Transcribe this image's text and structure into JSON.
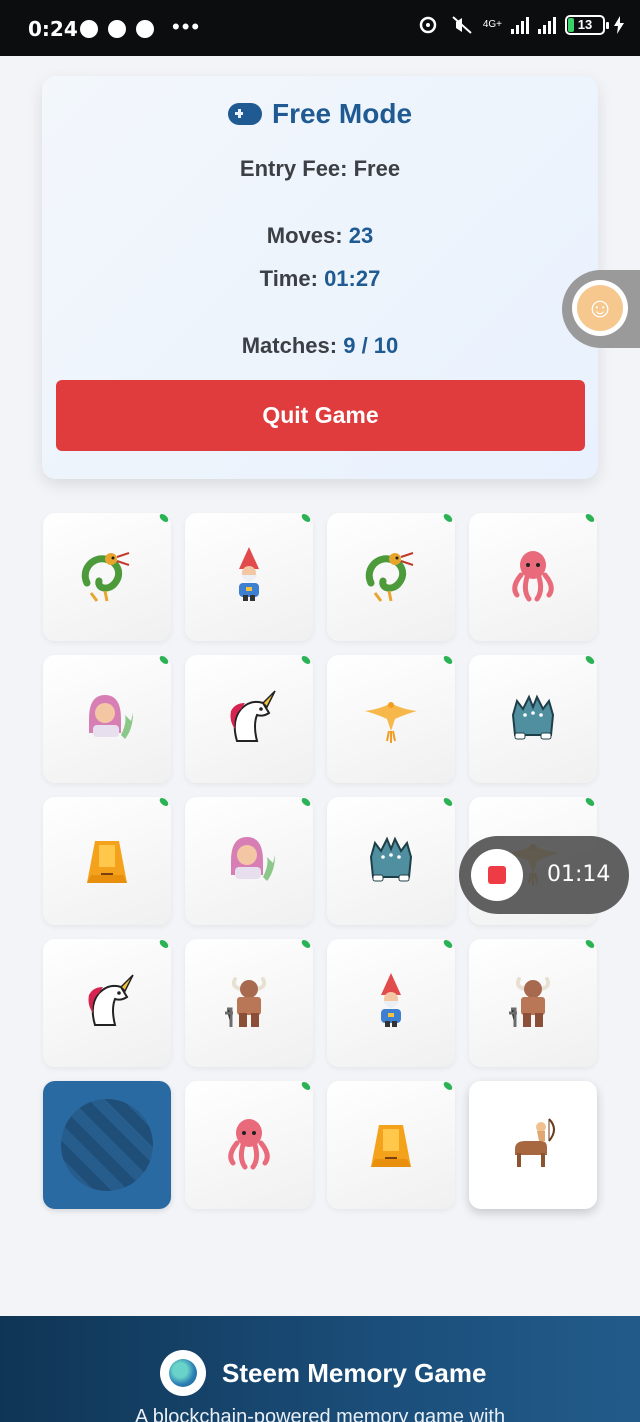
{
  "status_bar": {
    "time": "0:24",
    "more": "•••",
    "network": "4G+",
    "battery": "13"
  },
  "game_info": {
    "mode_title": "Free Mode",
    "entry_fee_label": "Entry Fee: Free",
    "moves_label": "Moves:",
    "moves_value": "23",
    "time_label": "Time:",
    "time_value": "01:27",
    "matches_label": "Matches:",
    "matches_value": "9 / 10",
    "quit_label": "Quit Game"
  },
  "board": {
    "cards": [
      {
        "symbol": "dragon-icon",
        "state": "matched"
      },
      {
        "symbol": "gnome-icon",
        "state": "matched"
      },
      {
        "symbol": "dragon-icon",
        "state": "matched"
      },
      {
        "symbol": "octopus-icon",
        "state": "matched"
      },
      {
        "symbol": "mermaid-icon",
        "state": "matched"
      },
      {
        "symbol": "unicorn-icon",
        "state": "matched"
      },
      {
        "symbol": "phoenix-icon",
        "state": "matched"
      },
      {
        "symbol": "cerberus-icon",
        "state": "matched"
      },
      {
        "symbol": "sphinx-icon",
        "state": "matched"
      },
      {
        "symbol": "mermaid-icon",
        "state": "matched"
      },
      {
        "symbol": "cerberus-icon",
        "state": "matched"
      },
      {
        "symbol": "phoenix-icon",
        "state": "matched"
      },
      {
        "symbol": "unicorn-icon",
        "state": "matched"
      },
      {
        "symbol": "minotaur-icon",
        "state": "matched"
      },
      {
        "symbol": "gnome-icon",
        "state": "matched"
      },
      {
        "symbol": "minotaur-icon",
        "state": "matched"
      },
      {
        "symbol": "card-back",
        "state": "hidden"
      },
      {
        "symbol": "octopus-icon",
        "state": "matched"
      },
      {
        "symbol": "sphinx-icon",
        "state": "matched"
      },
      {
        "symbol": "centaur-icon",
        "state": "revealed"
      }
    ]
  },
  "screen_recorder": {
    "elapsed": "01:14"
  },
  "footer": {
    "title": "Steem Memory Game",
    "subtitle": "A blockchain-powered memory game with"
  },
  "colors": {
    "accent": "#1f5a92",
    "danger": "#e03c3e",
    "matched_tick": "#2bb255",
    "card_back": "#2a6aa3"
  }
}
